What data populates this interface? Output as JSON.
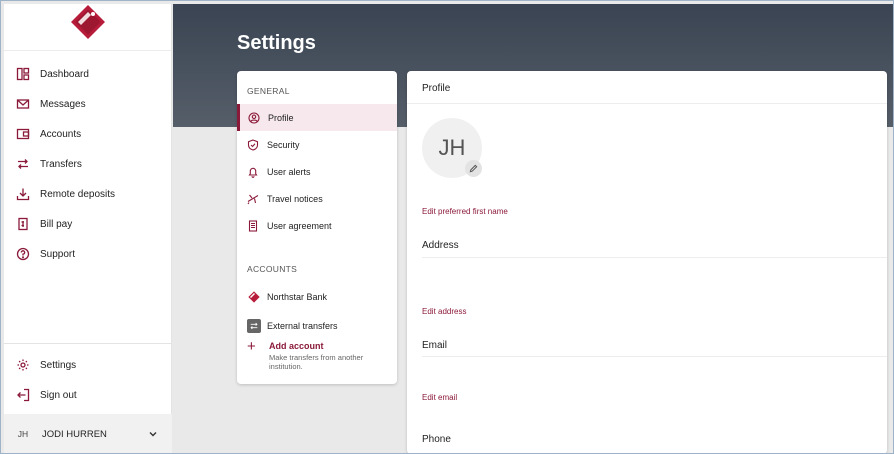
{
  "sidebar": {
    "nav": [
      {
        "label": "Dashboard",
        "icon": "dashboard-icon"
      },
      {
        "label": "Messages",
        "icon": "mail-icon"
      },
      {
        "label": "Accounts",
        "icon": "wallet-icon"
      },
      {
        "label": "Transfers",
        "icon": "transfer-arrows-icon"
      },
      {
        "label": "Remote deposits",
        "icon": "download-icon"
      },
      {
        "label": "Bill pay",
        "icon": "bill-icon"
      },
      {
        "label": "Support",
        "icon": "help-icon"
      }
    ],
    "bottom": [
      {
        "label": "Settings",
        "icon": "gear-icon"
      },
      {
        "label": "Sign out",
        "icon": "sign-out-icon"
      }
    ],
    "user": {
      "initials": "JH",
      "name": "JODI HURREN"
    }
  },
  "page": {
    "title": "Settings"
  },
  "settings_nav": {
    "general_label": "GENERAL",
    "general": [
      {
        "label": "Profile",
        "icon": "user-circle-icon",
        "active": true
      },
      {
        "label": "Security",
        "icon": "shield-icon"
      },
      {
        "label": "User alerts",
        "icon": "bell-icon"
      },
      {
        "label": "Travel notices",
        "icon": "airplane-icon"
      },
      {
        "label": "User agreement",
        "icon": "document-icon"
      }
    ],
    "accounts_label": "ACCOUNTS",
    "accounts": [
      {
        "label": "Northstar Bank",
        "icon": "bank-logo-icon"
      },
      {
        "label": "External transfers",
        "icon": "external-transfer-icon"
      }
    ],
    "add_account": {
      "label": "Add account",
      "sub": "Make transfers from another institution."
    }
  },
  "profile": {
    "header": "Profile",
    "initials": "JH",
    "edit_first_name": "Edit preferred first name",
    "address_title": "Address",
    "edit_address": "Edit address",
    "email_title": "Email",
    "edit_email": "Edit email",
    "phone_title": "Phone"
  },
  "colors": {
    "accent": "#8b1a3a",
    "hero": "#46505c"
  }
}
